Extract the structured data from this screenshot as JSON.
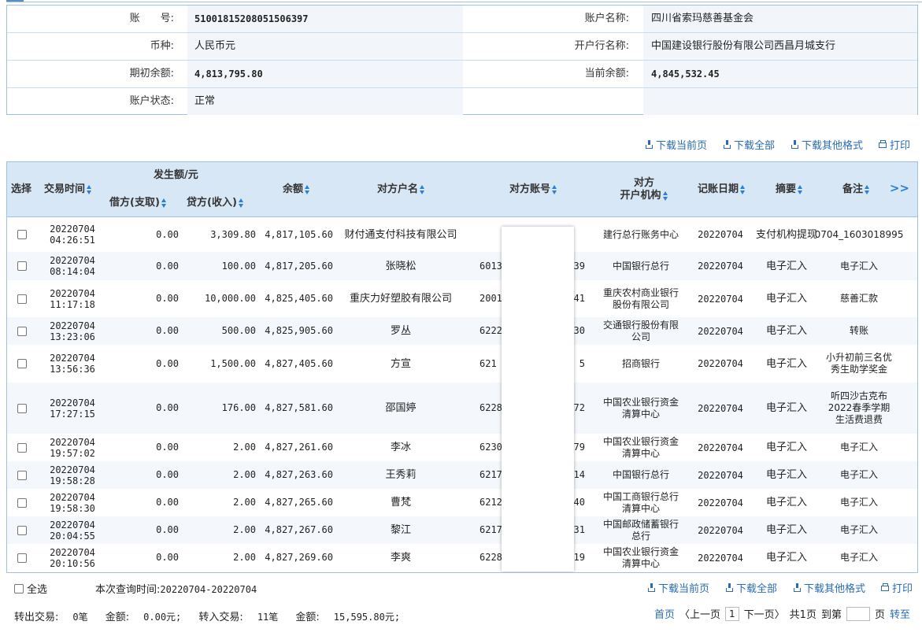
{
  "account": {
    "rows": [
      {
        "label1": "账　　号:",
        "value1": "51001815208051506397",
        "label2": "账户名称:",
        "value2": "四川省索玛慈善基金会"
      },
      {
        "label1": "币种:",
        "value1": "人民币元",
        "label2": "开户行名称:",
        "value2": "中国建设银行股份有限公司西昌月城支行"
      },
      {
        "label1": "期初余额:",
        "value1": "4,813,795.80",
        "label2": "当前余额:",
        "value2": "4,845,532.45"
      },
      {
        "label1": "账户状态:",
        "value1": "正常",
        "label2": "",
        "value2": ""
      }
    ]
  },
  "toolbar": {
    "download_current": "下载当前页",
    "download_all": "下载全部",
    "download_other": "下载其他格式",
    "print": "打印"
  },
  "table": {
    "headers": {
      "select": "选择",
      "time": "交易时间",
      "amount_group": "发生额/元",
      "debit": "借方(支取)",
      "credit": "贷方(收入)",
      "balance": "余额",
      "counter_name": "对方户名",
      "counter_acct": "对方账号",
      "counter_org_1": "对方",
      "counter_org_2": "开户机构",
      "post_date": "记账日期",
      "summary": "摘要",
      "remark": "备注",
      "more": ">>"
    },
    "rows": [
      {
        "date": "20220704",
        "time": "04:26:51",
        "debit": "0.00",
        "credit": "3,309.80",
        "balance": "4,817,105.60",
        "name": "财付通支付科技有限公司",
        "acct_head": "",
        "acct_tail": "",
        "org": "建行总行账务中心",
        "post": "20220704",
        "summary": "支付机构提现",
        "remark": "0704_1603018995"
      },
      {
        "date": "20220704",
        "time": "08:14:04",
        "debit": "0.00",
        "credit": "100.00",
        "balance": "4,817,205.60",
        "name": "张晓松",
        "acct_head": "6013",
        "acct_tail": "39",
        "org": "中国银行总行",
        "post": "20220704",
        "summary": "电子汇入",
        "remark": "电子汇入"
      },
      {
        "date": "20220704",
        "time": "11:17:18",
        "debit": "0.00",
        "credit": "10,000.00",
        "balance": "4,825,405.60",
        "name": "重庆力好塑胶有限公司",
        "acct_head": "2001",
        "acct_tail": "41",
        "org": "重庆农村商业银行股份有限公司",
        "post": "20220704",
        "summary": "电子汇入",
        "remark": "慈善汇款"
      },
      {
        "date": "20220704",
        "time": "13:23:06",
        "debit": "0.00",
        "credit": "500.00",
        "balance": "4,825,905.60",
        "name": "罗丛",
        "acct_head": "6222",
        "acct_tail": "30",
        "org": "交通银行股份有限公司",
        "post": "20220704",
        "summary": "电子汇入",
        "remark": "转账"
      },
      {
        "date": "20220704",
        "time": "13:56:36",
        "debit": "0.00",
        "credit": "1,500.00",
        "balance": "4,827,405.60",
        "name": "方宣",
        "acct_head": "621",
        "acct_tail": "5",
        "org": "招商银行",
        "post": "20220704",
        "summary": "电子汇入",
        "remark": "小升初前三名优秀生助学奖金"
      },
      {
        "date": "20220704",
        "time": "17:27:15",
        "debit": "0.00",
        "credit": "176.00",
        "balance": "4,827,581.60",
        "name": "邵国婷",
        "acct_head": "6228",
        "acct_tail": "72",
        "org": "中国农业银行资金清算中心",
        "post": "20220704",
        "summary": "电子汇入",
        "remark": "听四沙古克布2022春季学期生活费退费"
      },
      {
        "date": "20220704",
        "time": "19:57:02",
        "debit": "0.00",
        "credit": "2.00",
        "balance": "4,827,261.60",
        "name": "李冰",
        "acct_head": "6230",
        "acct_tail": "79",
        "org": "中国农业银行资金清算中心",
        "post": "20220704",
        "summary": "电子汇入",
        "remark": "电子汇入"
      },
      {
        "date": "20220704",
        "time": "19:58:28",
        "debit": "0.00",
        "credit": "2.00",
        "balance": "4,827,263.60",
        "name": "王秀莉",
        "acct_head": "6217",
        "acct_tail": "14",
        "org": "中国银行总行",
        "post": "20220704",
        "summary": "电子汇入",
        "remark": "电子汇入"
      },
      {
        "date": "20220704",
        "time": "19:58:30",
        "debit": "0.00",
        "credit": "2.00",
        "balance": "4,827,265.60",
        "name": "曹梵",
        "acct_head": "6212",
        "acct_tail": "40",
        "org": "中国工商银行总行清算中心",
        "post": "20220704",
        "summary": "电子汇入",
        "remark": "电子汇入"
      },
      {
        "date": "20220704",
        "time": "20:04:55",
        "debit": "0.00",
        "credit": "2.00",
        "balance": "4,827,267.60",
        "name": "黎江",
        "acct_head": "6217",
        "acct_tail": "31",
        "org": "中国邮政储蓄银行总行",
        "post": "20220704",
        "summary": "电子汇入",
        "remark": "电子汇入"
      },
      {
        "date": "20220704",
        "time": "20:10:56",
        "debit": "0.00",
        "credit": "2.00",
        "balance": "4,827,269.60",
        "name": "李爽",
        "acct_head": "6228",
        "acct_tail": "19",
        "org": "中国农业银行资金清算中心",
        "post": "20220704",
        "summary": "电子汇入",
        "remark": "电子汇入"
      }
    ]
  },
  "footer": {
    "select_all": "全选",
    "query_time_label": "本次查询时间:",
    "query_time_value": "20220704-20220704",
    "summary": {
      "out_label": "转出交易:",
      "out_count": "0笔",
      "out_amount_label": "金额:",
      "out_amount": "0.00元;",
      "in_label": "转入交易:",
      "in_count": "11笔",
      "in_amount_label": "金额:",
      "in_amount": "15,595.80元;"
    },
    "pager": {
      "first": "首页",
      "prev": "〈上一页",
      "current": "1",
      "next": "下一页〉",
      "total": "共1页",
      "goto_label": "到第",
      "page_unit": "页",
      "go": "转至"
    }
  },
  "colors": {
    "accent": "#2a6bb5",
    "header_bg": "#d8e7f6",
    "border": "#9fc0e0"
  }
}
